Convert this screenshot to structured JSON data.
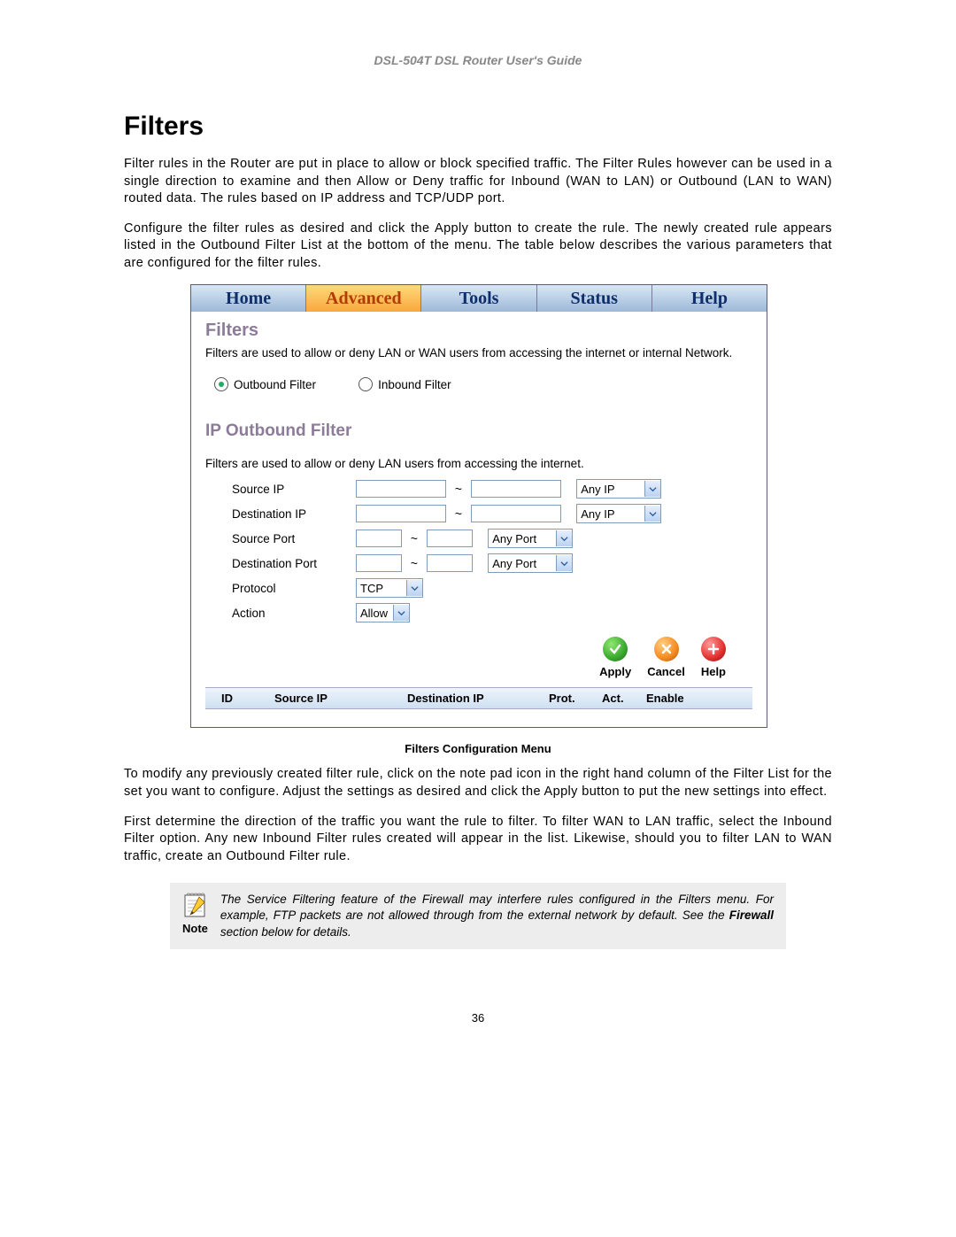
{
  "doc_header": "DSL-504T DSL Router User's Guide",
  "section_heading": "Filters",
  "para1": "Filter rules in the Router are put in place to allow or block specified traffic. The Filter Rules however can be used in a single direction to examine and then Allow or Deny traffic for Inbound (WAN to LAN) or Outbound (LAN to WAN) routed data. The rules based on IP address and TCP/UDP port.",
  "para2": "Configure the filter rules as desired and click the Apply button to create the rule. The newly created rule appears listed in the Outbound Filter List at the bottom of the menu. The table below describes the various parameters that are configured for the filter rules.",
  "tabs": [
    "Home",
    "Advanced",
    "Tools",
    "Status",
    "Help"
  ],
  "active_tab_index": 1,
  "panel_title": "Filters",
  "panel_desc": "Filters are used to allow or deny LAN or WAN users from accessing the internet or internal Network.",
  "radio_outbound": "Outbound Filter",
  "radio_inbound": "Inbound Filter",
  "sub_title": "IP Outbound Filter",
  "sub_desc": "Filters are used to allow or deny LAN users from accessing the internet.",
  "labels": {
    "src_ip": "Source IP",
    "dst_ip": "Destination IP",
    "src_port": "Source Port",
    "dst_port": "Destination Port",
    "protocol": "Protocol",
    "action": "Action"
  },
  "selects": {
    "any_ip": "Any IP",
    "any_port": "Any Port",
    "protocol": "TCP",
    "action": "Allow"
  },
  "buttons": {
    "apply": "Apply",
    "cancel": "Cancel",
    "help": "Help"
  },
  "list_headers": {
    "id": "ID",
    "src": "Source IP",
    "dst": "Destination IP",
    "prot": "Prot.",
    "act": "Act.",
    "enable": "Enable"
  },
  "caption": "Filters Configuration Menu",
  "para3": "To modify any previously created filter rule, click on the note pad icon in the right hand column of the Filter List for the set you want to configure.  Adjust the settings as desired and click the Apply button to put the new settings into effect.",
  "para4": "First determine the direction of the traffic you want the rule to filter. To filter WAN to LAN traffic, select the Inbound Filter option. Any new Inbound Filter rules created will appear in the list. Likewise, should you to filter LAN to WAN traffic, create an Outbound Filter rule.",
  "note_label": "Note",
  "note_text_pre": "The Service Filtering feature of the Firewall may interfere rules configured in the Filters menu. For example, FTP packets are not allowed through from the external network by default. See the ",
  "note_text_bold": "Firewall",
  "note_text_post": " section below for details.",
  "page_number": "36"
}
